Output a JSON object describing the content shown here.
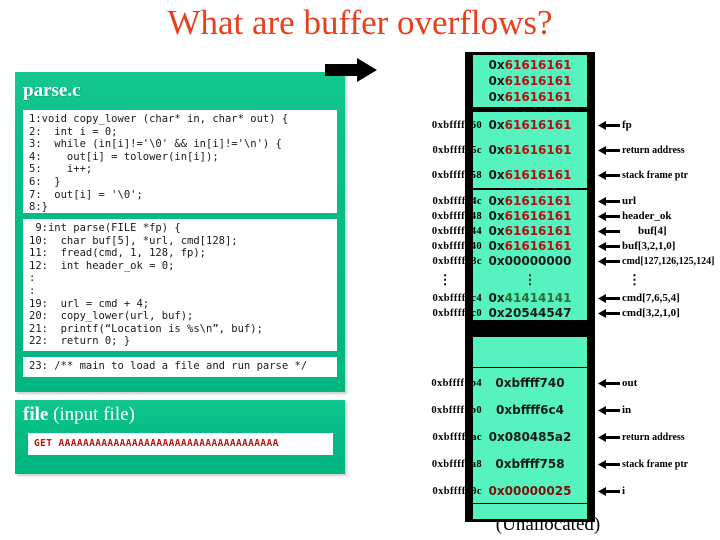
{
  "title": "What are buffer overflows?",
  "left_panel": {
    "filename": "parse.c",
    "code_block_1": "1:void copy_lower (char* in, char* out) {\n2:  int i = 0;\n3:  while (in[i]!='\\0' && in[i]!='\\n') {\n4:    out[i] = tolower(in[i]);\n5:    i++;\n6:  }\n7:  out[i] = '\\0';\n8:}",
    "code_block_2": " 9:int parse(FILE *fp) {\n10:  char buf[5], *url, cmd[128];\n11:  fread(cmd, 1, 128, fp);\n12:  int header_ok = 0;\n:\n:\n19:  url = cmd + 4;\n20:  copy_lower(url, buf);\n21:  printf(“Location is %s\\n”, buf);\n22:  return 0; }",
    "code_block_3": "23: /** main to load a file and run parse */"
  },
  "file_panel": {
    "label_bold": "file",
    "label_rest": " (input file)",
    "content": "GET AAAAAAAAAAAAAAAAAAAAAAAAAAAAAAAAAAAA"
  },
  "colors": {
    "title": "#E8401C",
    "panel_green": "#06BE86",
    "stack_cyan": "#56F2C0",
    "hex_red": "#B3130F",
    "hex_green": "#2F6B33",
    "hex_dark_red": "#7A1408"
  },
  "stack": {
    "unallocated_label": "(Unallocated)",
    "rows": [
      {
        "addr": "",
        "prefix": "0x",
        "value": "61616161",
        "value_color": "red",
        "label": ""
      },
      {
        "addr": "",
        "prefix": "0x",
        "value": "61616161",
        "value_color": "red",
        "label": ""
      },
      {
        "addr": "",
        "prefix": "0x",
        "value": "61616161",
        "value_color": "red",
        "label": ""
      },
      {
        "addr": "0xbffff760",
        "prefix": "0x",
        "value": "61616161",
        "value_color": "red",
        "label": "fp"
      },
      {
        "addr": "0xbffff75c",
        "prefix": "0x",
        "value": "61616161",
        "value_color": "red",
        "label": "return address"
      },
      {
        "addr": "0xbffff758",
        "prefix": "0x",
        "value": "61616161",
        "value_color": "red",
        "label": "stack frame ptr"
      },
      {
        "addr": "0xbffff74c",
        "prefix": "0x",
        "value": "61616161",
        "value_color": "red",
        "label": "url"
      },
      {
        "addr": "0xbffff748",
        "prefix": "0x",
        "value": "61616161",
        "value_color": "red",
        "label": "header_ok"
      },
      {
        "addr": "0xbffff744",
        "prefix": "0x",
        "value": "61616161",
        "value_color": "red",
        "label": "buf[4]"
      },
      {
        "addr": "0xbffff740",
        "prefix": "0x",
        "value": "61616161",
        "value_color": "red",
        "label": "buf[3,2,1,0]"
      },
      {
        "addr": "0xbffff73c",
        "prefix": "0x",
        "value": "00000000",
        "value_color": "black",
        "label": "cmd[127,126,125,124]"
      },
      {
        "addr": "⋮",
        "prefix": "",
        "value": "⋮",
        "value_color": "black",
        "label": "⋮"
      },
      {
        "addr": "0xbffff6c4",
        "prefix": "0x",
        "value": "41414141",
        "value_color": "green",
        "label": "cmd[7,6,5,4]"
      },
      {
        "addr": "0xbffff6c0",
        "prefix": "0x",
        "value": "20544547",
        "value_color": "black",
        "label": "cmd[3,2,1,0]"
      },
      {
        "addr": "0xbffff6b4",
        "prefix": "",
        "value": "0xbffff740",
        "value_color": "black",
        "label": "out"
      },
      {
        "addr": "0xbffff6b0",
        "prefix": "",
        "value": "0xbffff6c4",
        "value_color": "black",
        "label": "in"
      },
      {
        "addr": "0xbffff6ac",
        "prefix": "",
        "value": "0x080485a2",
        "value_color": "black",
        "label": "return address"
      },
      {
        "addr": "0xbffff6a8",
        "prefix": "",
        "value": "0xbffff758",
        "value_color": "black",
        "label": "stack frame ptr"
      },
      {
        "addr": "0xbffff69c",
        "prefix": "",
        "value": "0x00000025",
        "value_color": "darkred",
        "label": "i"
      }
    ]
  }
}
